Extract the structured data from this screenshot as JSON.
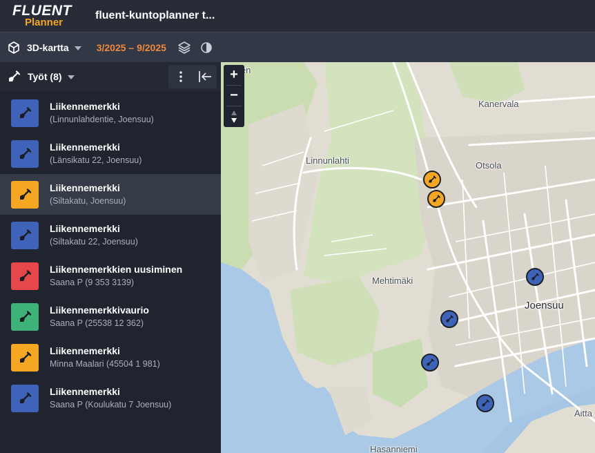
{
  "header": {
    "logo_main": "FLUENT",
    "logo_sub": "Planner",
    "title": "fluent-kuntoplanner t..."
  },
  "toolbar": {
    "view_label": "3D-kartta",
    "date_range": "3/2025 – 9/2025",
    "icons": [
      "cube-icon",
      "layers-icon",
      "contrast-icon"
    ]
  },
  "sidebar": {
    "title": "Työt (8)",
    "jobs": [
      {
        "title": "Liikennemerkki",
        "subtitle": "(Linnunlahdentie, Joensuu)",
        "color": "#3f63b8"
      },
      {
        "title": "Liikennemerkki",
        "subtitle": "(Länsikatu 22, Joensuu)",
        "color": "#3f63b8"
      },
      {
        "title": "Liikennemerkki",
        "subtitle": "(Siltakatu, Joensuu)",
        "color": "#f5a623"
      },
      {
        "title": "Liikennemerkki",
        "subtitle": "(Siltakatu 22, Joensuu)",
        "color": "#3f63b8"
      },
      {
        "title": "Liikennemerkkien uusiminen",
        "subtitle": "Saana P (9 353 3139)",
        "color": "#e5474a"
      },
      {
        "title": "Liikennemerkkivaurio",
        "subtitle": "Saana P (25538 12 362)",
        "color": "#3fb27a"
      },
      {
        "title": "Liikennemerkki",
        "subtitle": "Minna Maalari (45504 1 981)",
        "color": "#f5a623"
      },
      {
        "title": "Liikennemerkki",
        "subtitle": "Saana P (Koulukatu 7 Joensuu)",
        "color": "#3f63b8"
      }
    ]
  },
  "map": {
    "zoom_in": "+",
    "zoom_out": "−",
    "places": {
      "kanervala": "Kanervala",
      "linnunlahti": "Linnunlahti",
      "otsola": "Otsola",
      "mehtimaki": "Mehtimäki",
      "joensuu": "Joensuu",
      "aitta": "Aitta",
      "hasanniemi": "Hasanniemi",
      "top_cut": "ien"
    },
    "colors": {
      "water": "#a9c9e6",
      "park": "#c9ddb0",
      "land": "#e2ddd2",
      "urban": "#dad5ca"
    }
  }
}
